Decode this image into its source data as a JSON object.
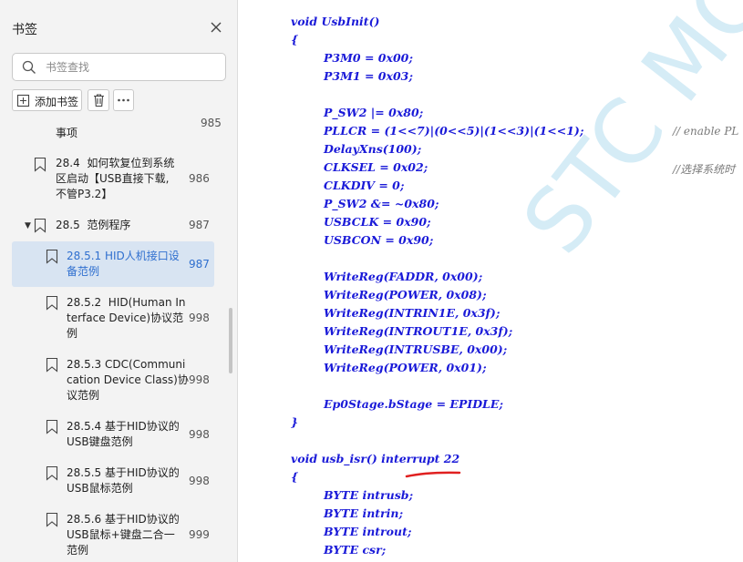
{
  "sidebar": {
    "title": "书签",
    "search_placeholder": "书签查找",
    "add_bookmark_label": "添加书签",
    "items": [
      {
        "text": "事项",
        "page": "985"
      },
      {
        "text": "28.4  如何软复位到系统\n区启动【USB直接下载,\n不管P3.2】",
        "page": "986"
      },
      {
        "text": "28.5  范例程序",
        "page": "987"
      },
      {
        "text": "28.5.1 HID人机接口设\n备范例",
        "page": "987"
      },
      {
        "text": "28.5.2  HID(Human In\nterface Device)协议范\n例",
        "page": "998"
      },
      {
        "text": "28.5.3 CDC(Communi\ncation Device Class)协\n议范例",
        "page": "998"
      },
      {
        "text": "28.5.4 基于HID协议的\nUSB键盘范例",
        "page": "998"
      },
      {
        "text": "28.5.5 基于HID协议的\nUSB鼠标范例",
        "page": "998"
      },
      {
        "text": "28.5.6 基于HID协议的\nUSB鼠标+键盘二合一\n范例",
        "page": "999"
      }
    ]
  },
  "document": {
    "watermark": "STC MCU",
    "code_lines": [
      "void UsbInit()",
      "{",
      "P3M0 = 0x00;",
      "P3M1 = 0x03;",
      "P_SW2 |= 0x80;",
      "PLLCR = (1<<7)|(0<<5)|(1<<3)|(1<<1);",
      "DelayXns(100);",
      "CLKSEL = 0x02;",
      "CLKDIV = 0;",
      "P_SW2 &= ~0x80;",
      "USBCLK = 0x90;",
      "USBCON = 0x90;",
      "WriteReg(FADDR, 0x00);",
      "WriteReg(POWER, 0x08);",
      "WriteReg(INTRIN1E, 0x3f);",
      "WriteReg(INTROUT1E, 0x3f);",
      "WriteReg(INTRUSBE, 0x00);",
      "WriteReg(POWER, 0x01);",
      "Ep0Stage.bStage = EPIDLE;",
      "}",
      "void usb_isr() interrupt 22",
      "{",
      "BYTE intrusb;",
      "BYTE intrin;",
      "BYTE introut;",
      "BYTE csr;"
    ],
    "comments": [
      "// enable PL",
      "//选择系统时"
    ]
  }
}
